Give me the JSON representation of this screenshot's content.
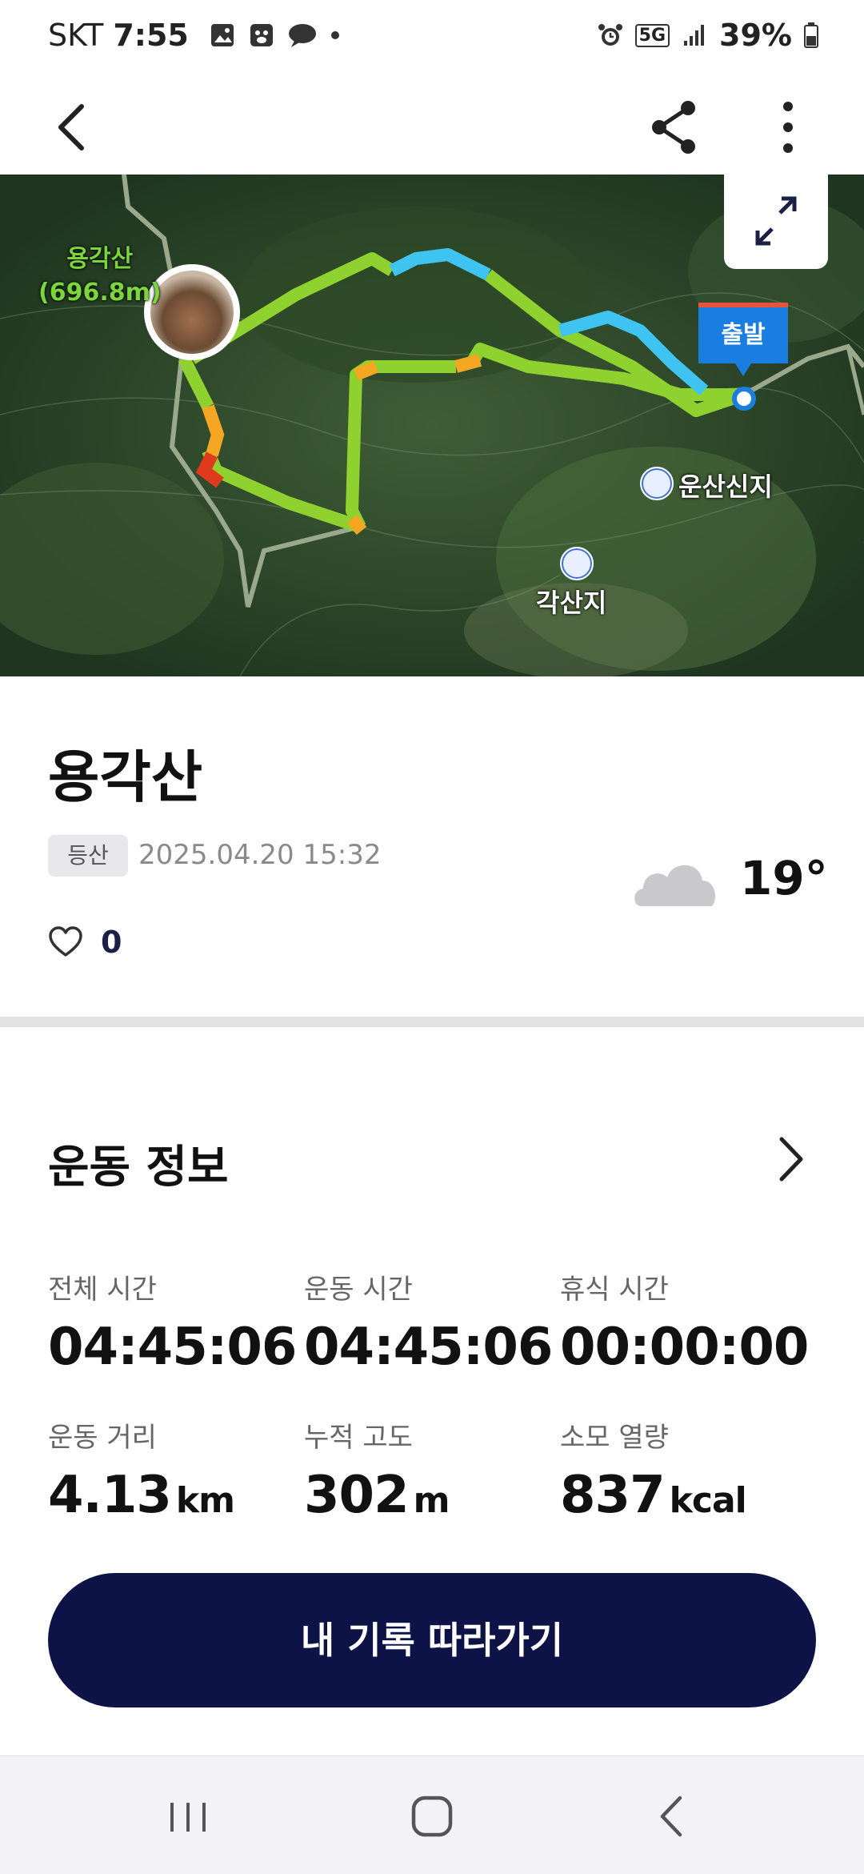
{
  "status_bar": {
    "carrier": "SKT",
    "time": "7:55",
    "network": "5G",
    "battery": "39%"
  },
  "app_bar": {
    "back_icon": "back-arrow-icon",
    "share_icon": "share-icon",
    "more_icon": "more-vertical-icon"
  },
  "map": {
    "peak_label": "용각산",
    "peak_elevation": "(696.8m)",
    "start_label": "출발",
    "poi_1": "운산신지",
    "poi_2": "각산지"
  },
  "activity": {
    "title": "용각산",
    "type_badge": "등산",
    "datetime": "2025.04.20 15:32",
    "likes": "0",
    "temperature": "19°"
  },
  "exercise_info": {
    "section_title": "운동 정보",
    "stats": [
      {
        "label": "전체 시간",
        "value": "04:45:06",
        "unit": ""
      },
      {
        "label": "운동 시간",
        "value": "04:45:06",
        "unit": ""
      },
      {
        "label": "휴식 시간",
        "value": "00:00:00",
        "unit": ""
      },
      {
        "label": "운동 거리",
        "value": "4.13",
        "unit": "km"
      },
      {
        "label": "누적 고도",
        "value": "302",
        "unit": "m"
      },
      {
        "label": "소모 열량",
        "value": "837",
        "unit": "kcal"
      }
    ]
  },
  "cta": {
    "label": "내 기록 따라가기"
  },
  "colors": {
    "primary": "#0d1347",
    "route_green": "#8fd12f",
    "route_blue": "#3fc3f0",
    "route_orange": "#f5a623",
    "route_red": "#e03a1e"
  }
}
